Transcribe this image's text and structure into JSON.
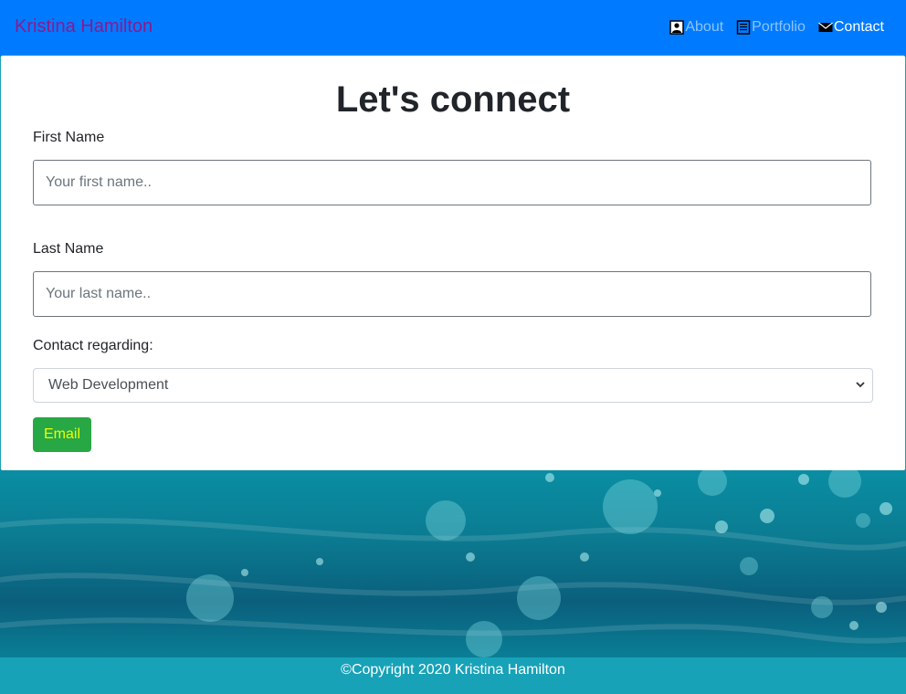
{
  "navbar": {
    "brand": "Kristina Hamilton",
    "items": [
      {
        "label": "About",
        "icon": "person-icon",
        "active": false
      },
      {
        "label": "Portfolio",
        "icon": "document-icon",
        "active": false
      },
      {
        "label": "Contact",
        "icon": "envelope-icon",
        "active": true
      }
    ]
  },
  "form": {
    "title": "Let's connect",
    "first_name_label": "First Name",
    "first_name_placeholder": "Your first name..",
    "last_name_label": "Last Name",
    "last_name_placeholder": "Your last name..",
    "regarding_label": "Contact regarding:",
    "regarding_selected": "Web Development",
    "submit_label": "Email"
  },
  "footer": {
    "text": "©Copyright 2020 Kristina Hamilton"
  },
  "colors": {
    "navbar": "#007bff",
    "brand": "#8b1a8f",
    "submit_button": "#28a745",
    "submit_text": "#eaff00",
    "footer": "#17a2b8"
  }
}
